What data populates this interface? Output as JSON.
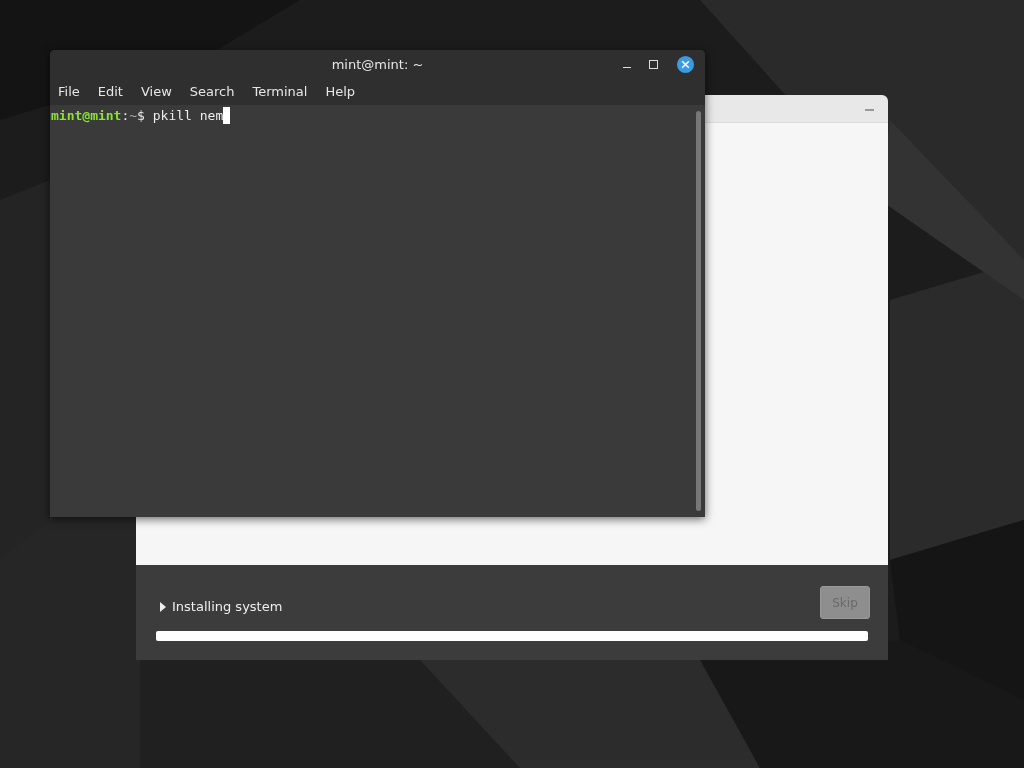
{
  "installer": {
    "status": {
      "label": "Installing system",
      "expanded": false
    },
    "skip_button": {
      "label": "Skip",
      "disabled": true
    },
    "progress": {
      "level": 1
    }
  },
  "terminal": {
    "window": {
      "title": "mint@mint: ~"
    },
    "menu": [
      "File",
      "Edit",
      "View",
      "Search",
      "Terminal",
      "Help"
    ],
    "prompt": {
      "user_host": "mint@mint",
      "separator": ":",
      "path": "~",
      "symbol": "$",
      "command": "pkill nem"
    }
  }
}
